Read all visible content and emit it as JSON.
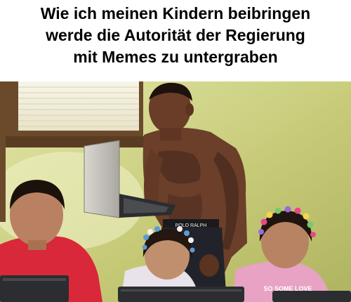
{
  "caption": {
    "lines": [
      "Wie ich meinen Kindern beibringen",
      "werde die Autorität der Regierung",
      "mit Memes zu untergraben"
    ]
  },
  "photo": {
    "description_icon": "photo-icon",
    "waistband_text": "POLO RALPH",
    "shirt_text": "SO SOME LOVE"
  },
  "colors": {
    "wall": "#c9cd7a",
    "wall_light": "#dfe3a2",
    "window_frame": "#6b4a2c",
    "skin_dark": "#6b3f2a",
    "shirt_red": "#d8283a",
    "shirt_pink": "#e7a2c4",
    "laptop_dark": "#2b2d30"
  }
}
